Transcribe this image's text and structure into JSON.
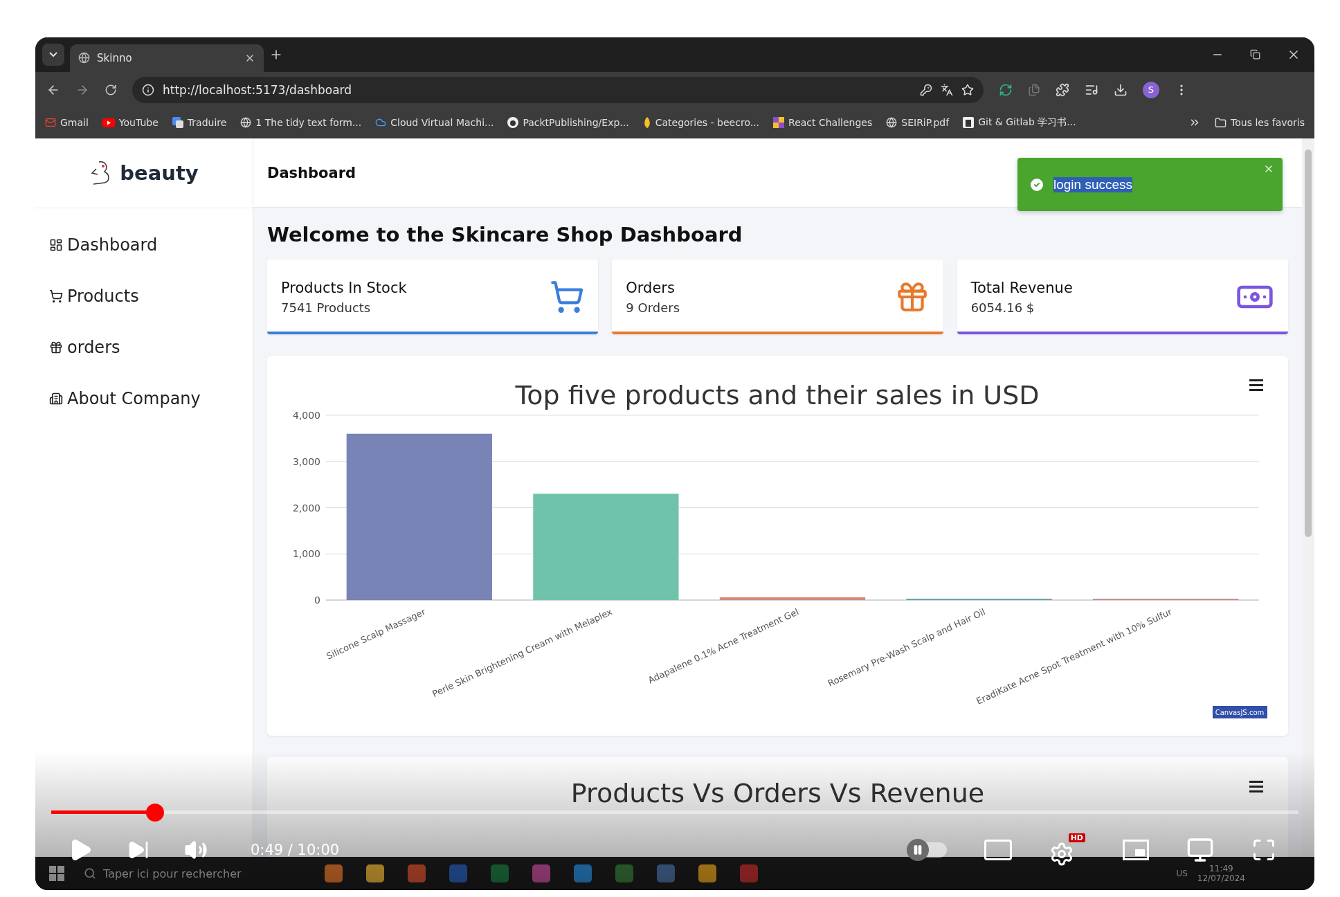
{
  "browser": {
    "tabs": [
      {
        "title": "Skinno",
        "selected": true
      }
    ],
    "url": "http://localhost:5173/dashboard",
    "profile_initial": "S",
    "bookmarks": [
      {
        "label": "Gmail"
      },
      {
        "label": "YouTube"
      },
      {
        "label": "Traduire"
      },
      {
        "label": "1 The tidy text form..."
      },
      {
        "label": "Cloud Virtual Machi..."
      },
      {
        "label": "PacktPublishing/Exp..."
      },
      {
        "label": "Categories - beecro..."
      },
      {
        "label": "React Challenges"
      },
      {
        "label": "SEIRiP.pdf"
      },
      {
        "label": "Git & Gitlab 学习书..."
      }
    ],
    "all_bookmarks": "Tous les favoris"
  },
  "sidebar": {
    "brand": "beauty",
    "items": [
      {
        "label": "Dashboard"
      },
      {
        "label": "Products"
      },
      {
        "label": "orders"
      },
      {
        "label": "About Company"
      }
    ]
  },
  "header": {
    "title": "Dashboard"
  },
  "toast": {
    "message": "login success"
  },
  "welcome": "Welcome to the Skincare Shop Dashboard",
  "stats": [
    {
      "title": "Products In Stock",
      "value": "7541 Products",
      "color": "#3b7ddd"
    },
    {
      "title": "Orders",
      "value": "9 Orders",
      "color": "#e8792b"
    },
    {
      "title": "Total Revenue",
      "value": "6054.16 $",
      "color": "#7b55e0"
    }
  ],
  "charts": [
    {
      "credit": "CanvasJS.com",
      "chart_data": {
        "type": "bar",
        "title": "Top five products and their sales in USD",
        "categories": [
          "Silicone Scalp Massager",
          "Perle Skin Brightening Cream with Melaplex",
          "Adapalene 0.1% Acne Treatment Gel",
          "Rosemary Pre-Wash Scalp and Hair Oil",
          "EradiKate Acne Spot Treatment with 10% Sulfur"
        ],
        "stacked": true,
        "grid": true,
        "series": [
          {
            "color": "#7884b5",
            "values": [
              3600,
              null,
              null,
              null,
              null
            ]
          },
          {
            "color": "#70c3ab",
            "values": [
              null,
              2300,
              null,
              null,
              null
            ]
          },
          {
            "color": "#d68a77",
            "values": [
              null,
              null,
              60,
              null,
              null
            ]
          },
          {
            "color": "#6aa4a8",
            "values": [
              null,
              null,
              null,
              30,
              null
            ]
          },
          {
            "color": "#c4908c",
            "values": [
              null,
              null,
              null,
              null,
              30
            ]
          }
        ],
        "ylim": [
          0,
          4000
        ],
        "yticks": [
          {
            "value": 0,
            "label": "0"
          },
          {
            "value": 1000,
            "label": "1,000"
          },
          {
            "value": 2000,
            "label": "2,000"
          },
          {
            "value": 3000,
            "label": "3,000"
          },
          {
            "value": 4000,
            "label": "4,000"
          }
        ]
      }
    },
    {
      "title": "Products Vs Orders Vs Revenue"
    }
  ],
  "player": {
    "level": 0.083,
    "autoplay": false,
    "time": "0:49 / 10:00",
    "hd_badge": "HD"
  },
  "taskbar": {
    "search_placeholder": "Taper ici pour rechercher",
    "language": "US",
    "time": "11:49",
    "date": "12/07/2024"
  }
}
